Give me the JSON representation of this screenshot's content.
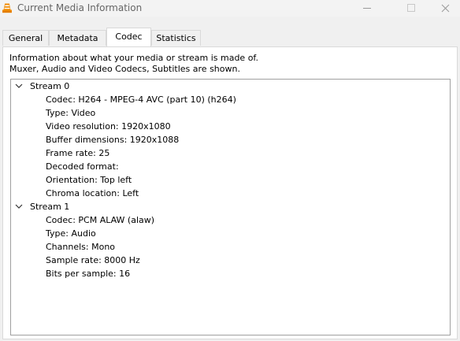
{
  "window": {
    "title": "Current Media Information",
    "icon": "vlc-cone-icon"
  },
  "tabs": [
    {
      "label": "General"
    },
    {
      "label": "Metadata"
    },
    {
      "label": "Codec",
      "active": true
    },
    {
      "label": "Statistics"
    }
  ],
  "info": {
    "line1": "Information about what your media or stream is made of.",
    "line2": "Muxer, Audio and Video Codecs, Subtitles are shown."
  },
  "streams": [
    {
      "label": "Stream 0",
      "expanded": true,
      "items": [
        "Codec: H264 - MPEG-4 AVC (part 10) (h264)",
        "Type: Video",
        "Video resolution: 1920x1080",
        "Buffer dimensions: 1920x1088",
        "Frame rate: 25",
        "Decoded format:",
        "Orientation: Top left",
        "Chroma location: Left"
      ]
    },
    {
      "label": "Stream 1",
      "expanded": true,
      "items": [
        "Codec: PCM ALAW (alaw)",
        "Type: Audio",
        "Channels: Mono",
        "Sample rate: 8000 Hz",
        "Bits per sample: 16"
      ]
    }
  ],
  "colors": {
    "accent_orange": "#f08a00",
    "title_text": "#666666",
    "panel_bg": "#ffffff",
    "window_bg": "#f0f0f0"
  }
}
